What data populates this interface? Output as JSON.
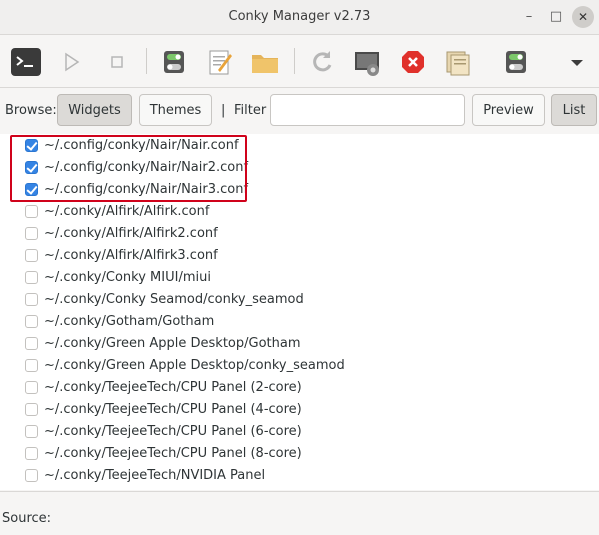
{
  "window": {
    "title": "Conky Manager v2.73",
    "minimize_glyph": "–",
    "maximize_glyph": "□",
    "close_glyph": "✕"
  },
  "toolbar": {
    "icons": [
      "terminal-icon",
      "play-icon",
      "stop-icon",
      "toggle-icon",
      "edit-icon",
      "folder-icon",
      "refresh-icon",
      "settings-icon",
      "kill-icon",
      "import-icon",
      "toggle2-icon",
      "dropdown-icon"
    ]
  },
  "browse": {
    "label": "Browse:",
    "widgets": "Widgets",
    "themes": "Themes",
    "separator": "|",
    "filter_label": "Filter",
    "filter_value": "",
    "preview": "Preview",
    "list": "List"
  },
  "items": [
    {
      "label": "~/.config/conky/Nair/Nair.conf",
      "checked": true
    },
    {
      "label": "~/.config/conky/Nair/Nair2.conf",
      "checked": true
    },
    {
      "label": "~/.config/conky/Nair/Nair3.conf",
      "checked": true
    },
    {
      "label": "~/.conky/Alfirk/Alfirk.conf",
      "checked": false
    },
    {
      "label": "~/.conky/Alfirk/Alfirk2.conf",
      "checked": false
    },
    {
      "label": "~/.conky/Alfirk/Alfirk3.conf",
      "checked": false
    },
    {
      "label": "~/.conky/Conky MIUI/miui",
      "checked": false
    },
    {
      "label": "~/.conky/Conky Seamod/conky_seamod",
      "checked": false
    },
    {
      "label": "~/.conky/Gotham/Gotham",
      "checked": false
    },
    {
      "label": "~/.conky/Green Apple Desktop/Gotham",
      "checked": false
    },
    {
      "label": "~/.conky/Green Apple Desktop/conky_seamod",
      "checked": false
    },
    {
      "label": "~/.conky/TeejeeTech/CPU Panel (2-core)",
      "checked": false
    },
    {
      "label": "~/.conky/TeejeeTech/CPU Panel (4-core)",
      "checked": false
    },
    {
      "label": "~/.conky/TeejeeTech/CPU Panel (6-core)",
      "checked": false
    },
    {
      "label": "~/.conky/TeejeeTech/CPU Panel (8-core)",
      "checked": false
    },
    {
      "label": "~/.conky/TeejeeTech/NVIDIA Panel",
      "checked": false
    }
  ],
  "status": {
    "label": "Source:"
  },
  "colors": {
    "accent": "#3584e4",
    "highlight_border": "#d0021b"
  }
}
